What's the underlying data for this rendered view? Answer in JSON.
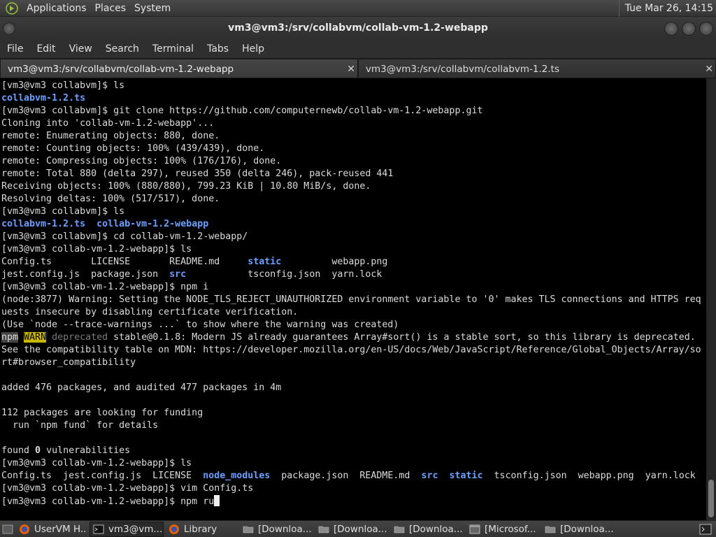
{
  "top_panel": {
    "menus": [
      "Applications",
      "Places",
      "System"
    ],
    "clock": "Tue Mar 26, 14:15"
  },
  "window": {
    "title": "vm3@vm3:/srv/collabvm/collab-vm-1.2-webapp"
  },
  "menubar": [
    "File",
    "Edit",
    "View",
    "Search",
    "Terminal",
    "Tabs",
    "Help"
  ],
  "tabs": [
    {
      "label": "vm3@vm3:/srv/collabvm/collab-vm-1.2-webapp",
      "active": true
    },
    {
      "label": "vm3@vm3:/srv/collabvm/collabvm-1.2.ts",
      "active": false
    }
  ],
  "terminal": {
    "lines": [
      "[vm3@vm3 collabvm]$ ls",
      "collabvm-1.2.ts",
      "[vm3@vm3 collabvm]$ git clone https://github.com/computernewb/collab-vm-1.2-webapp.git",
      "Cloning into 'collab-vm-1.2-webapp'...",
      "remote: Enumerating objects: 880, done.",
      "remote: Counting objects: 100% (439/439), done.",
      "remote: Compressing objects: 100% (176/176), done.",
      "remote: Total 880 (delta 297), reused 350 (delta 246), pack-reused 441",
      "Receiving objects: 100% (880/880), 799.23 KiB | 10.80 MiB/s, done.",
      "Resolving deltas: 100% (517/517), done.",
      "[vm3@vm3 collabvm]$ ls",
      "collabvm-1.2.ts  collab-vm-1.2-webapp",
      "[vm3@vm3 collabvm]$ cd collab-vm-1.2-webapp/",
      "[vm3@vm3 collab-vm-1.2-webapp]$ ls",
      "Config.ts       LICENSE       README.md     static         webapp.png",
      "jest.config.js  package.json  src           tsconfig.json  yarn.lock",
      "[vm3@vm3 collab-vm-1.2-webapp]$ npm i",
      "(node:3877) Warning: Setting the NODE_TLS_REJECT_UNAUTHORIZED environment variable to '0' makes TLS connections and HTTPS req",
      "uests insecure by disabling certificate verification.",
      "(Use `node --trace-warnings ...` to show where the warning was created)",
      "npm WARN deprecated stable@0.1.8: Modern JS already guarantees Array#sort() is a stable sort, so this library is deprecated.",
      "See the compatibility table on MDN: https://developer.mozilla.org/en-US/docs/Web/JavaScript/Reference/Global_Objects/Array/so",
      "rt#browser_compatibility",
      "",
      "added 476 packages, and audited 477 packages in 4m",
      "",
      "112 packages are looking for funding",
      "  run `npm fund` for details",
      "",
      "found 0 vulnerabilities",
      "[vm3@vm3 collab-vm-1.2-webapp]$ ls",
      "Config.ts  jest.config.js  LICENSE  node_modules  package.json  README.md  src  static  tsconfig.json  webapp.png  yarn.lock",
      "[vm3@vm3 collab-vm-1.2-webapp]$ vim Config.ts",
      "[vm3@vm3 collab-vm-1.2-webapp]$ npm ru"
    ]
  },
  "taskbar": {
    "items": [
      {
        "label": "UserVM H...",
        "icon": "firefox-icon",
        "active": false
      },
      {
        "label": "vm3@vm...",
        "icon": "terminal-icon",
        "active": true
      },
      {
        "label": "Library",
        "icon": "firefox-icon",
        "active": false
      },
      {
        "label": "[Downloa...",
        "icon": "folder-icon",
        "active": false
      },
      {
        "label": "[Downloa...",
        "icon": "folder-icon",
        "active": false
      },
      {
        "label": "[Downloa...",
        "icon": "folder-icon",
        "active": false
      },
      {
        "label": "[Microsof...",
        "icon": "window-icon",
        "active": false
      },
      {
        "label": "[Downloa...",
        "icon": "folder-icon",
        "active": false
      }
    ]
  },
  "colors": {
    "dir_blue": "#6aa0ff",
    "warn_yellow": "#c9b600",
    "terminal_bg": "#000000"
  }
}
